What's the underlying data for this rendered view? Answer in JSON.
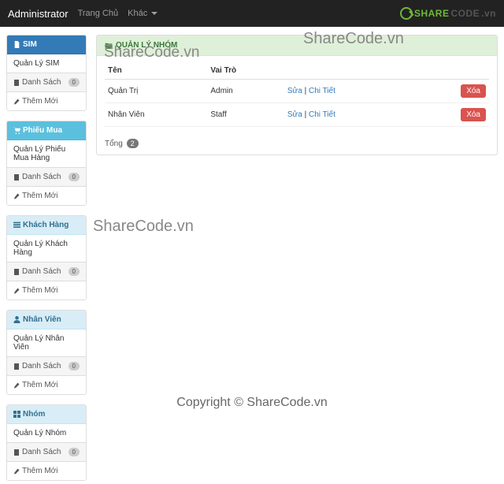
{
  "navbar": {
    "brand": "Administrator",
    "home": "Trang Chủ",
    "other": "Khác",
    "logo1": "SHARE",
    "logo2": "CODE",
    "logo3": ".vn"
  },
  "sidebar": [
    {
      "title": "SIM",
      "variant": "blue",
      "icon": "sim",
      "body": "Quản Lý SIM",
      "list_label": "Danh Sách",
      "list_badge": "0",
      "add_label": "Thêm Mới"
    },
    {
      "title": "Phiếu Mua",
      "variant": "teal",
      "icon": "cart",
      "body": "Quản Lý Phiếu Mua Hàng",
      "list_label": "Danh Sách",
      "list_badge": "0",
      "add_label": "Thêm Mới"
    },
    {
      "title": "Khách Hàng",
      "variant": "lblue",
      "icon": "list",
      "body": "Quản Lý Khách Hàng",
      "list_label": "Danh Sách",
      "list_badge": "0",
      "add_label": "Thêm Mới"
    },
    {
      "title": "Nhân Viên",
      "variant": "lblue",
      "icon": "user",
      "body": "Quản Lý Nhân Viên",
      "list_label": "Danh Sách",
      "list_badge": "0",
      "add_label": "Thêm Mới"
    },
    {
      "title": "Nhóm",
      "variant": "lblue",
      "icon": "grid",
      "body": "Quản Lý Nhóm",
      "list_label": "Danh Sách",
      "list_badge": "0",
      "add_label": "Thêm Mới"
    }
  ],
  "main": {
    "title": "QUẢN LÝ NHÓM",
    "icon": "folder",
    "cols": [
      "Tên",
      "Vai Trò",
      "",
      ""
    ],
    "rows": [
      {
        "name": "Quản Trị",
        "role": "Admin",
        "edit": "Sửa",
        "detail": "Chi Tiết",
        "del": "Xóa"
      },
      {
        "name": "Nhân Viên",
        "role": "Staff",
        "edit": "Sửa",
        "detail": "Chi Tiết",
        "del": "Xóa"
      }
    ],
    "total_label": "Tổng",
    "total_count": "2"
  },
  "watermarks": {
    "w1": "ShareCode.vn",
    "w2": "ShareCode.vn",
    "w3": "ShareCode.vn",
    "footer": "Copyright © ShareCode.vn"
  }
}
